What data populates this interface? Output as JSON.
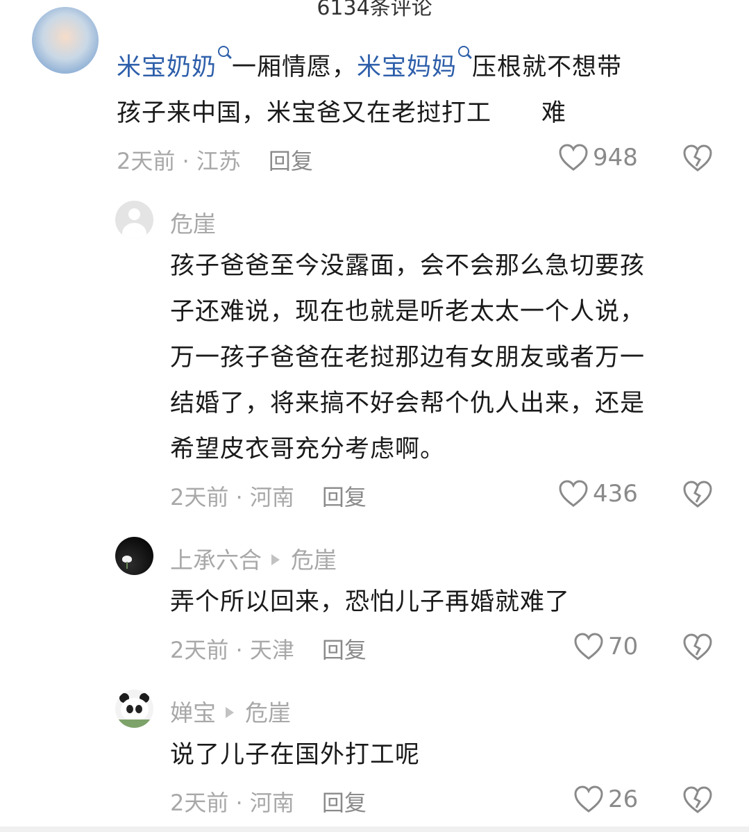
{
  "header": {
    "title": "6134条评论"
  },
  "comments": [
    {
      "mention1": "米宝奶奶",
      "text1": "一厢情愿，",
      "mention2": "米宝妈妈",
      "text2": "压根就不想带",
      "line2": "孩子来中国，米宝爸又在老挝打工　　难",
      "time": "2天前",
      "location": "江苏",
      "reply_label": "回复",
      "likes": "948"
    },
    {
      "username": "危崖",
      "lines": [
        "孩子爸爸至今没露面，会不会那么急切要孩",
        "子还难说，现在也就是听老太太一个人说，",
        "万一孩子爸爸在老挝那边有女朋友或者万一",
        "结婚了，将来搞不好会帮个仇人出来，还是",
        "希望皮衣哥充分考虑啊。"
      ],
      "time": "2天前",
      "location": "河南",
      "reply_label": "回复",
      "likes": "436"
    },
    {
      "username": "上承六合",
      "reply_to": "危崖",
      "text": "弄个所以回来，恐怕儿子再婚就难了",
      "time": "2天前",
      "location": "天津",
      "reply_label": "回复",
      "likes": "70"
    },
    {
      "username": "婵宝",
      "reply_to": "危崖",
      "text": "说了儿子在国外打工呢",
      "time": "2天前",
      "location": "河南",
      "reply_label": "回复",
      "likes": "26"
    }
  ],
  "icons": {
    "like": "heart-outline-icon",
    "dislike": "broken-heart-icon",
    "search": "search-icon",
    "reply_arrow": "triangle-right-icon"
  },
  "colors": {
    "mention": "#2e5faa",
    "muted": "#a8a8a8",
    "text": "#1a1a1a"
  }
}
